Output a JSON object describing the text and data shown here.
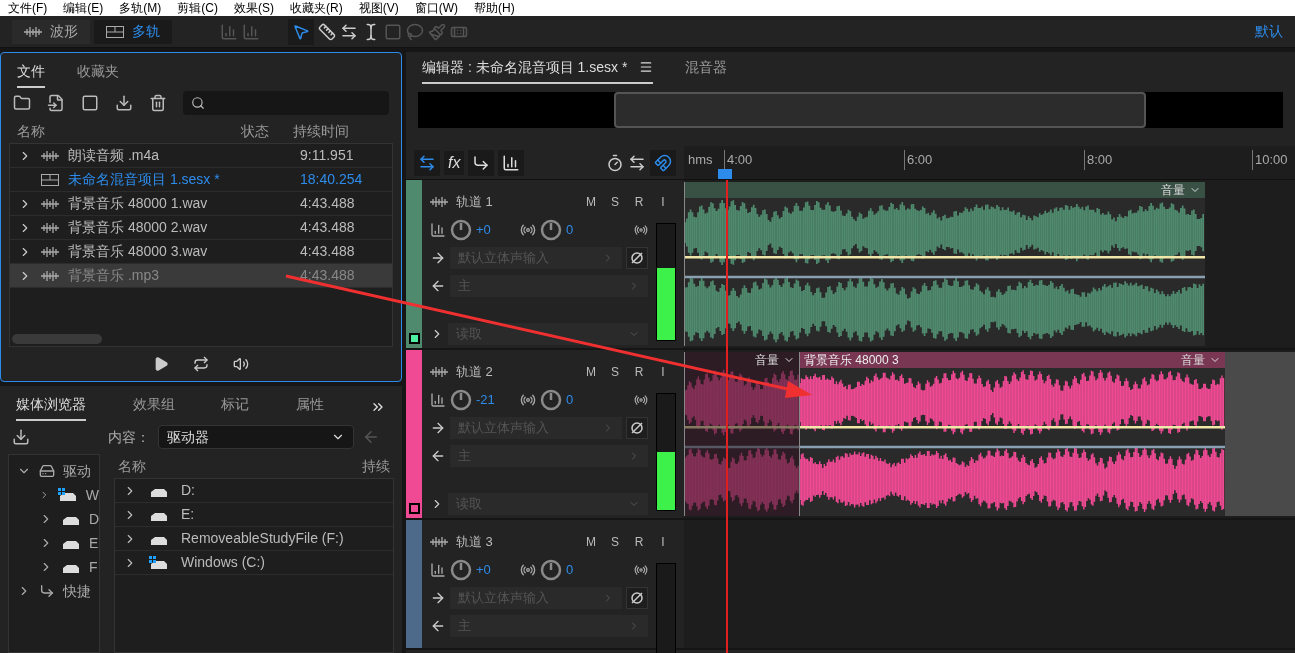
{
  "menu": [
    "文件(F)",
    "编辑(E)",
    "多轨(M)",
    "剪辑(C)",
    "效果(S)",
    "收藏夹(R)",
    "视图(V)",
    "窗口(W)",
    "帮助(H)"
  ],
  "view_tabs": [
    {
      "label": "波形",
      "kind": "waveform",
      "selected": false
    },
    {
      "label": "多轨",
      "kind": "multitrack",
      "selected": true
    }
  ],
  "workspace": "默认",
  "files_panel": {
    "tabs": [
      {
        "label": "文件",
        "selected": true
      },
      {
        "label": "收藏夹",
        "selected": false
      }
    ],
    "columns": [
      "名称",
      "状态",
      "持续时间"
    ],
    "rows": [
      {
        "name": "朗读音频 .m4a",
        "duration": "9:11.951",
        "kind": "audio",
        "current": false,
        "selected": false
      },
      {
        "name": "未命名混音项目 1.sesx *",
        "duration": "18:40.254",
        "kind": "session",
        "current": true,
        "selected": false
      },
      {
        "name": "背景音乐 48000 1.wav",
        "duration": "4:43.488",
        "kind": "audio",
        "current": false,
        "selected": false
      },
      {
        "name": "背景音乐 48000 2.wav",
        "duration": "4:43.488",
        "kind": "audio",
        "current": false,
        "selected": false
      },
      {
        "name": "背景音乐 48000 3.wav",
        "duration": "4:43.488",
        "kind": "audio",
        "current": false,
        "selected": false
      },
      {
        "name": "背景音乐 .mp3",
        "duration": "4:43.488",
        "kind": "audio",
        "current": false,
        "selected": true
      }
    ]
  },
  "media_panel": {
    "tabs": [
      {
        "label": "媒体浏览器",
        "selected": true
      },
      {
        "label": "效果组",
        "selected": false
      },
      {
        "label": "标记",
        "selected": false
      },
      {
        "label": "属性",
        "selected": false
      }
    ],
    "content_label": "内容：",
    "content_value": "驱动器",
    "tree": [
      {
        "label": "驱动",
        "kind": "drives",
        "expanded": true,
        "children": [
          {
            "label": "W",
            "kind": "windows"
          },
          {
            "label": "D",
            "kind": "drive"
          },
          {
            "label": "E",
            "kind": "drive"
          },
          {
            "label": "F",
            "kind": "drive"
          }
        ]
      },
      {
        "label": "快捷",
        "kind": "shortcut",
        "expanded": false
      }
    ],
    "columns": [
      "名称",
      "持续"
    ],
    "rows": [
      {
        "name": "D:",
        "kind": "drive"
      },
      {
        "name": "E:",
        "kind": "drive"
      },
      {
        "name": "RemoveableStudyFile (F:)",
        "kind": "drive"
      },
      {
        "name": "Windows (C:)",
        "kind": "windows"
      }
    ]
  },
  "editor": {
    "tabs": [
      {
        "label": "编辑器 : 未命名混音项目 1.sesx *",
        "selected": true
      },
      {
        "label": "混音器",
        "selected": false
      }
    ],
    "fx_label": "fx",
    "ruler_unit": "hms",
    "ruler_labels": [
      "4:00",
      "6:00",
      "8:00",
      "10:00"
    ]
  },
  "tracks": [
    {
      "name": "轨道 1",
      "color": "#4f8a6e",
      "buttons": [
        "M",
        "S",
        "R",
        "I"
      ],
      "volume": {
        "value": "+0"
      },
      "pan": {
        "value": "0"
      },
      "input": "默认立体声输入",
      "output": "主",
      "automation": "读取",
      "meter": {
        "level": 0.62
      },
      "armed": true,
      "clips": [
        {
          "kind": "audio",
          "param": "音量",
          "dim": false
        },
        {
          "kind": "empty"
        }
      ]
    },
    {
      "name": "轨道 2",
      "color": "#f04a94",
      "buttons": [
        "M",
        "S",
        "R",
        "I"
      ],
      "volume": {
        "value": "-21"
      },
      "pan": {
        "value": "0"
      },
      "input": "默认立体声输入",
      "output": "主",
      "automation": "读取",
      "meter": {
        "level": 0.5
      },
      "armed": false,
      "clips": [
        {
          "kind": "audio",
          "param": "音量",
          "dim": true
        },
        {
          "kind": "audio",
          "title": "背景音乐 48000 3",
          "param": "音量",
          "dim": false
        },
        {
          "kind": "gap"
        }
      ]
    },
    {
      "name": "轨道 3",
      "color": "#4e6a8a",
      "buttons": [
        "M",
        "S",
        "R",
        "I"
      ],
      "volume": {
        "value": "+0"
      },
      "pan": {
        "value": "0"
      },
      "input": "默认立体声输入",
      "output": "主"
    }
  ]
}
